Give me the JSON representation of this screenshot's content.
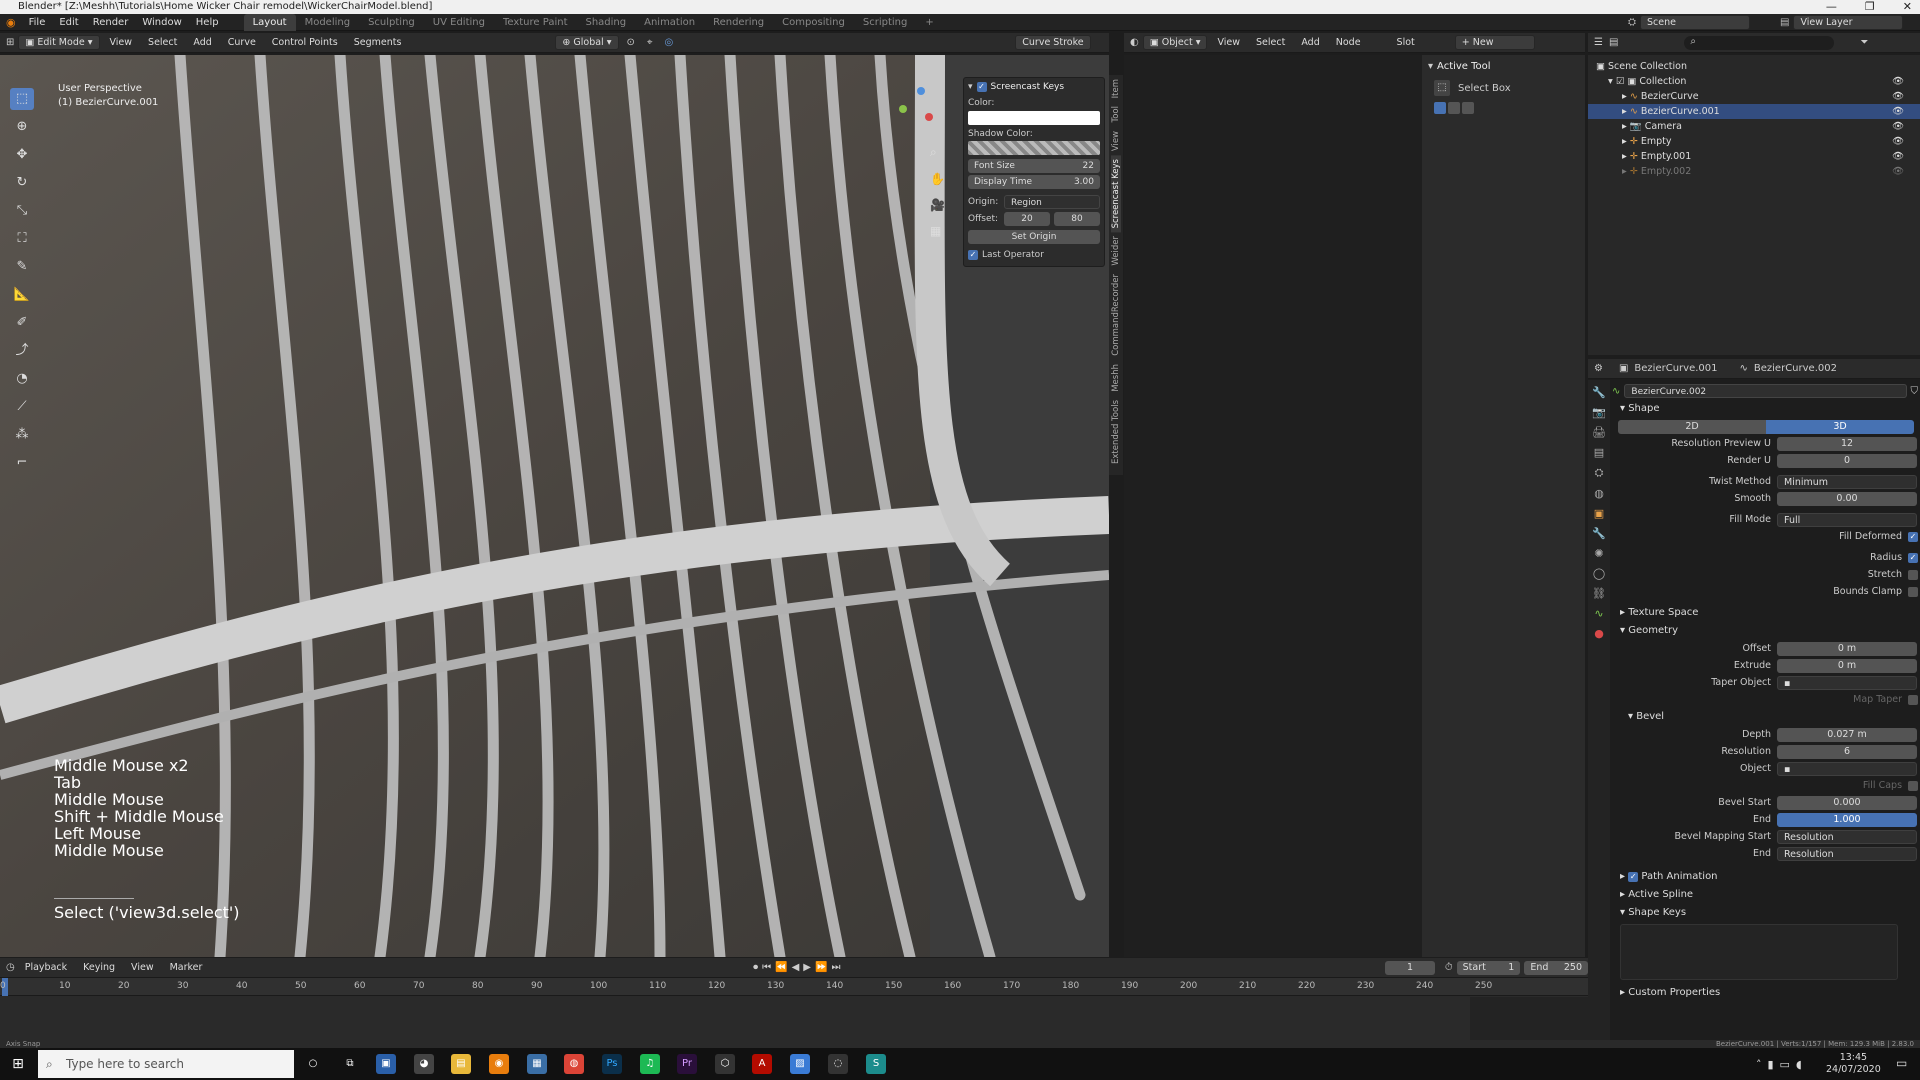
{
  "window": {
    "title": "Blender* [Z:\\Meshh\\Tutorials\\Home Wicker Chair remodel\\WickerChairModel.blend]",
    "controls": [
      "—",
      "❐",
      "✕"
    ]
  },
  "menubar": {
    "menus": [
      "File",
      "Edit",
      "Render",
      "Window",
      "Help"
    ],
    "workspaces": [
      "Layout",
      "Modeling",
      "Sculpting",
      "UV Editing",
      "Texture Paint",
      "Shading",
      "Animation",
      "Rendering",
      "Compositing",
      "Scripting"
    ],
    "add_tab": "+",
    "scene": "Scene",
    "view_layer": "View Layer"
  },
  "viewport_header": {
    "mode": "Edit Mode",
    "menus": [
      "View",
      "Select",
      "Add",
      "Curve",
      "Control Points",
      "Segments"
    ],
    "transform": "Global",
    "curve_stroke": "Curve Stroke"
  },
  "viewport": {
    "perspective": "User Perspective",
    "object": "(1) BezierCurve.001"
  },
  "keylog": [
    "Middle Mouse x2",
    "Tab",
    "Middle Mouse",
    "Shift + Middle Mouse",
    "Left Mouse",
    "Middle Mouse"
  ],
  "last_operator_text": "Select ('view3d.select')",
  "screencast_panel": {
    "title": "Screencast Keys",
    "color_label": "Color:",
    "shadow_label": "Shadow Color:",
    "font_size_label": "Font Size",
    "font_size": "22",
    "display_time_label": "Display Time",
    "display_time": "3.00",
    "origin_label": "Origin:",
    "origin": "Region",
    "offset_label": "Offset:",
    "offset_x": "20",
    "offset_y": "80",
    "set_origin": "Set Origin",
    "last_operator": "Last Operator"
  },
  "side_tabs": [
    "Item",
    "Tool",
    "View",
    "Screencast Keys",
    "Weider",
    "CommandRecorder",
    "Meshh",
    "Extended Tools"
  ],
  "node_header": {
    "mode": "Object",
    "menus": [
      "View",
      "Select",
      "Add",
      "Node"
    ],
    "slot": "Slot",
    "new": "New"
  },
  "active_tool": {
    "title": "Active Tool",
    "tool": "Select Box"
  },
  "outliner": {
    "root": "Scene Collection",
    "items": [
      {
        "name": "Collection",
        "level": 1
      },
      {
        "name": "BezierCurve",
        "level": 2
      },
      {
        "name": "BezierCurve.001",
        "level": 2
      },
      {
        "name": "Camera",
        "level": 2
      },
      {
        "name": "Empty",
        "level": 2
      },
      {
        "name": "Empty.001",
        "level": 2
      },
      {
        "name": "Empty.002",
        "level": 2
      }
    ]
  },
  "properties": {
    "breadcrumb_obj": "BezierCurve.001",
    "breadcrumb_data": "BezierCurve.002",
    "datablock": "BezierCurve.002",
    "shape": {
      "title": "Shape",
      "dim2": "2D",
      "dim3": "3D",
      "fields": [
        {
          "label": "Resolution Preview U",
          "value": "12",
          "type": "num"
        },
        {
          "label": "Render U",
          "value": "0",
          "type": "num"
        },
        {
          "label": "Twist Method",
          "value": "Minimum",
          "type": "drop"
        },
        {
          "label": "Smooth",
          "value": "0.00",
          "type": "num"
        },
        {
          "label": "Fill Mode",
          "value": "Full",
          "type": "drop"
        }
      ],
      "checks": [
        {
          "label": "Fill Deformed",
          "on": true
        },
        {
          "label": "Radius",
          "on": true
        },
        {
          "label": "Stretch",
          "on": false
        },
        {
          "label": "Bounds Clamp",
          "on": false
        }
      ]
    },
    "texture_space": "Texture Space",
    "geometry": {
      "title": "Geometry",
      "offset_label": "Offset",
      "offset": "0 m",
      "extrude_label": "Extrude",
      "extrude": "0 m",
      "taper_label": "Taper Object",
      "map_taper": "Map Taper"
    },
    "bevel": {
      "title": "Bevel",
      "depth_label": "Depth",
      "depth": "0.027 m",
      "resolution_label": "Resolution",
      "resolution": "6",
      "object_label": "Object",
      "fill_caps": "Fill Caps",
      "start_label": "Bevel Start",
      "start": "0.000",
      "end_label": "End",
      "end": "1.000",
      "map_start_label": "Bevel Mapping Start",
      "map_start": "Resolution",
      "map_end_label": "End",
      "map_end": "Resolution"
    },
    "path_animation": "Path Animation",
    "active_spline": "Active Spline",
    "shape_keys": "Shape Keys",
    "custom_properties": "Custom Properties"
  },
  "timeline": {
    "menus": [
      "Playback",
      "Keying",
      "View",
      "Marker"
    ],
    "frame": "1",
    "start_label": "Start",
    "start": "1",
    "end_label": "End",
    "end": "250",
    "ticks": [
      "0",
      "10",
      "20",
      "30",
      "40",
      "50",
      "60",
      "70",
      "80",
      "90",
      "100",
      "110",
      "120",
      "130",
      "140",
      "150",
      "160",
      "170",
      "180",
      "190",
      "200",
      "210",
      "220",
      "230",
      "240",
      "250"
    ]
  },
  "status": {
    "left": "Axis Snap",
    "right": "BezierCurve.001 | Verts:1/157 | Mem: 129.3 MiB | 2.83.0"
  },
  "taskbar": {
    "search": "Type here to search",
    "time": "13:45",
    "date": "24/07/2020"
  }
}
